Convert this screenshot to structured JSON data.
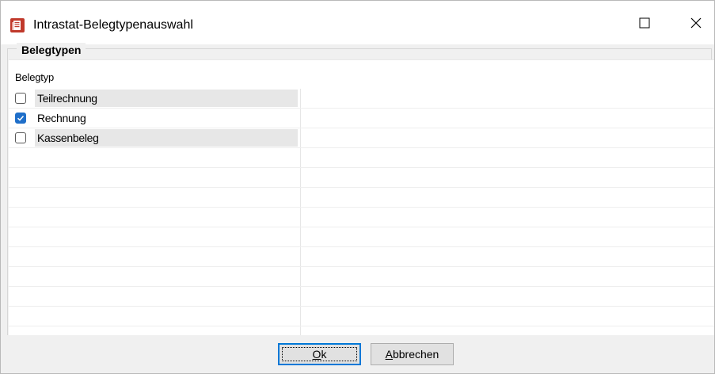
{
  "window": {
    "title": "Intrastat-Belegtypenauswahl",
    "icon": "document-list-icon",
    "accent_color": "#c0392b"
  },
  "titlebar_buttons": {
    "maximize_icon": "maximize-icon",
    "close_icon": "close-icon"
  },
  "group": {
    "label": "Belegtypen"
  },
  "grid": {
    "column_header": "Belegtyp",
    "rows": [
      {
        "label": "Teilrechnung",
        "checked": false
      },
      {
        "label": "Rechnung",
        "checked": true
      },
      {
        "label": "Kassenbeleg",
        "checked": false
      }
    ]
  },
  "buttons": {
    "ok_label": "Ok",
    "cancel_label": "Abbrechen"
  },
  "colors": {
    "checkbox_checked": "#1f6fc9",
    "ok_border": "#0078d7"
  }
}
